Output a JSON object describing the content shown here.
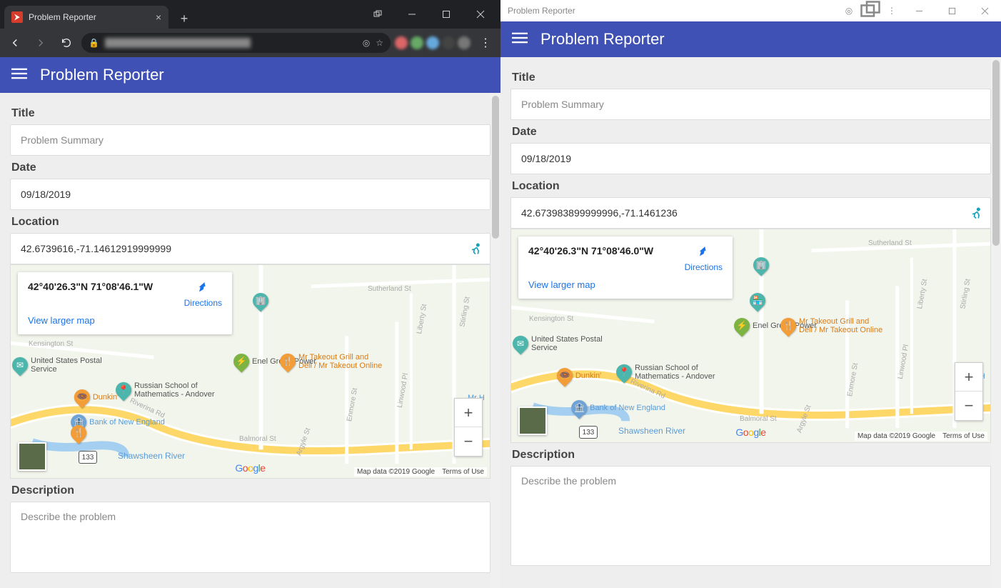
{
  "left": {
    "tab_title": "Problem Reporter",
    "window_title": "Problem Reporter",
    "app_title": "Problem Reporter",
    "labels": {
      "title": "Title",
      "date": "Date",
      "location": "Location",
      "description": "Description"
    },
    "fields": {
      "title_placeholder": "Problem Summary",
      "date_value": "09/18/2019",
      "location_value": "42.6739616,-71.14612919999999",
      "description_placeholder": "Describe the problem"
    },
    "map": {
      "coord_text": "42°40'26.3\"N 71°08'46.1\"W",
      "directions": "Directions",
      "larger": "View larger map",
      "attribution": "Map data ©2019 Google",
      "terms": "Terms of Use",
      "pois": {
        "enel": "Enel Green Power",
        "takeout": "Mr Takeout Grill and Deli / Mr Takeout Online",
        "russian": "Russian School of Mathematics - Andover",
        "bank": "Bank of New England",
        "dunkin": "Dunkin'",
        "usps": "United States Postal Service"
      },
      "streets": {
        "sutherland": "Sutherland St",
        "kensington": "Kensington St",
        "riverina": "Riverina Rd",
        "balmoral": "Balmoral St",
        "argyle": "Argyle St",
        "enmore": "Enmore St",
        "linwood": "Linwood Pl",
        "stirling": "Stirling St",
        "liberty": "Liberty St"
      },
      "river": "Shawsheen River",
      "route": "133",
      "poi_mh": "Mr H"
    }
  },
  "right": {
    "window_title": "Problem Reporter",
    "app_title": "Problem Reporter",
    "labels": {
      "title": "Title",
      "date": "Date",
      "location": "Location",
      "description": "Description"
    },
    "fields": {
      "title_placeholder": "Problem Summary",
      "date_value": "09/18/2019",
      "location_value": "42.673983899999996,-71.1461236",
      "description_placeholder": "Describe the problem"
    },
    "map": {
      "coord_text": "42°40'26.3\"N 71°08'46.0\"W",
      "directions": "Directions",
      "larger": "View larger map",
      "attribution": "Map data ©2019 Google",
      "terms": "Terms of Use",
      "pois": {
        "enel": "Enel Green Power",
        "takeout": "Mr Takeout Grill and Deli / Mr Takeout Online",
        "russian": "Russian School of Mathematics - Andover",
        "bank": "Bank of New England",
        "dunkin": "Dunkin'",
        "usps": "United States Postal Service"
      },
      "streets": {
        "sutherland": "Sutherland St",
        "kensington": "Kensington St",
        "riverina": "Riverina Rd",
        "balmoral": "Balmoral St",
        "argyle": "Argyle St",
        "enmore": "Enmore St",
        "linwood": "Linwood Pl",
        "stirling": "Stirling St",
        "liberty": "Liberty St"
      },
      "river": "Shawsheen River",
      "route": "133",
      "poi_mh": "Mr H"
    }
  }
}
